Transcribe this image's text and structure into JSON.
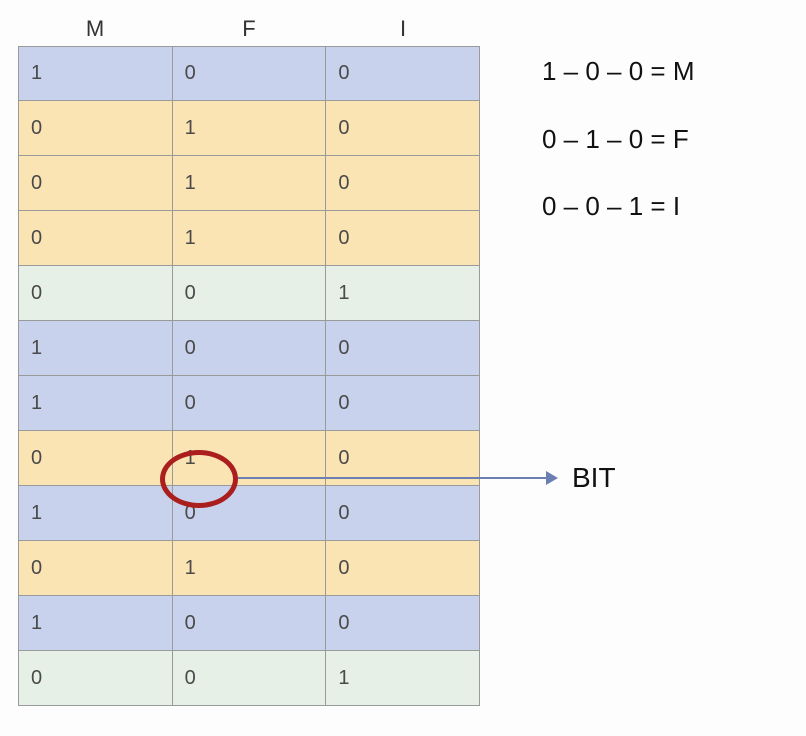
{
  "headers": [
    "M",
    "F",
    "I"
  ],
  "rows": [
    {
      "cells": [
        "1",
        "0",
        "0"
      ],
      "class": "blue"
    },
    {
      "cells": [
        "0",
        "1",
        "0"
      ],
      "class": "yellow"
    },
    {
      "cells": [
        "0",
        "1",
        "0"
      ],
      "class": "yellow"
    },
    {
      "cells": [
        "0",
        "1",
        "0"
      ],
      "class": "yellow"
    },
    {
      "cells": [
        "0",
        "0",
        "1"
      ],
      "class": "green"
    },
    {
      "cells": [
        "1",
        "0",
        "0"
      ],
      "class": "blue"
    },
    {
      "cells": [
        "1",
        "0",
        "0"
      ],
      "class": "blue"
    },
    {
      "cells": [
        "0",
        "1",
        "0"
      ],
      "class": "yellow"
    },
    {
      "cells": [
        "1",
        "0",
        "0"
      ],
      "class": "blue"
    },
    {
      "cells": [
        "0",
        "1",
        "0"
      ],
      "class": "yellow"
    },
    {
      "cells": [
        "1",
        "0",
        "0"
      ],
      "class": "blue"
    },
    {
      "cells": [
        "0",
        "0",
        "1"
      ],
      "class": "green"
    }
  ],
  "legend": [
    "1 – 0 – 0 = M",
    "0 – 1 – 0 = F",
    "0 – 0 – 1 = I"
  ],
  "bit_label": "BIT",
  "highlight": {
    "row": 7,
    "col": 1
  }
}
